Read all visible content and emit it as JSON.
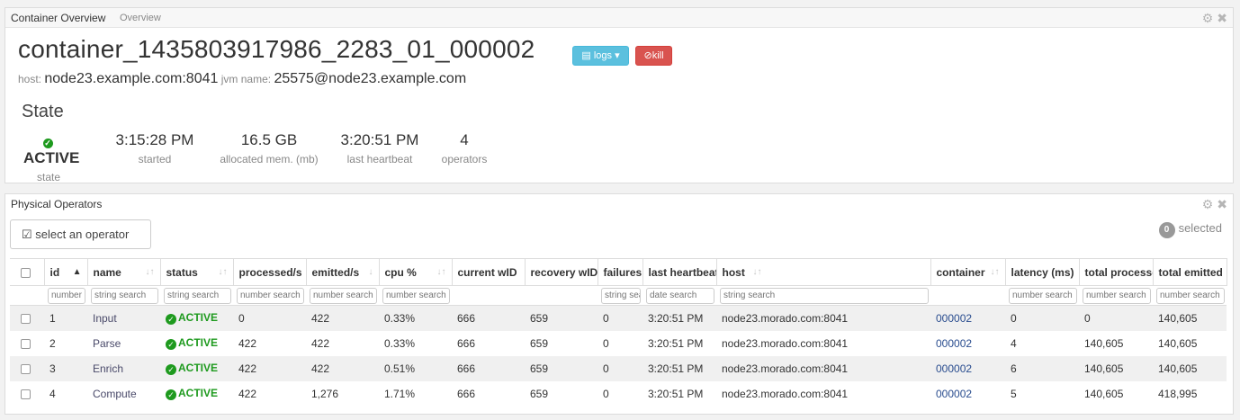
{
  "overview": {
    "title": "Container Overview",
    "subtitle": "Overview",
    "container_id": "container_1435803917986_2283_01_000002",
    "logs_label": "logs",
    "kill_label": "kill",
    "host_label": "host:",
    "host_value": "node23.example.com:8041",
    "jvm_label": "jvm name:",
    "jvm_value": "25575@node23.example.com",
    "state_title": "State",
    "stats": [
      {
        "value": "ACTIVE",
        "label": "state"
      },
      {
        "value": "3:15:28 PM",
        "label": "started"
      },
      {
        "value": "16.5 GB",
        "label": "allocated mem. (mb)"
      },
      {
        "value": "3:20:51 PM",
        "label": "last heartbeat"
      },
      {
        "value": "4",
        "label": "operators"
      }
    ]
  },
  "operators": {
    "title": "Physical Operators",
    "select_label": "select an operator",
    "selected_count": "0",
    "selected_label": "selected",
    "columns": [
      "id",
      "name",
      "status",
      "processed/s",
      "emitted/s",
      "cpu %",
      "current wID",
      "recovery wID",
      "failures",
      "last heartbeat",
      "host",
      "container",
      "latency (ms)",
      "total processed",
      "total emitted"
    ],
    "filters": [
      "number",
      "string search",
      "string search",
      "number search",
      "number search",
      "number search",
      "",
      "",
      "string search",
      "date search",
      "string search",
      "",
      "number search",
      "number search",
      "number search"
    ],
    "rows": [
      {
        "id": "1",
        "name": "Input",
        "status": "ACTIVE",
        "processed": "0",
        "emitted": "422",
        "cpu": "0.33%",
        "current_wid": "666",
        "recovery_wid": "659",
        "failures": "0",
        "last_heartbeat": "3:20:51 PM",
        "host": "node23.morado.com:8041",
        "container": "000002",
        "latency": "0",
        "total_processed": "0",
        "total_emitted": "140,605"
      },
      {
        "id": "2",
        "name": "Parse",
        "status": "ACTIVE",
        "processed": "422",
        "emitted": "422",
        "cpu": "0.33%",
        "current_wid": "666",
        "recovery_wid": "659",
        "failures": "0",
        "last_heartbeat": "3:20:51 PM",
        "host": "node23.morado.com:8041",
        "container": "000002",
        "latency": "4",
        "total_processed": "140,605",
        "total_emitted": "140,605"
      },
      {
        "id": "3",
        "name": "Enrich",
        "status": "ACTIVE",
        "processed": "422",
        "emitted": "422",
        "cpu": "0.51%",
        "current_wid": "666",
        "recovery_wid": "659",
        "failures": "0",
        "last_heartbeat": "3:20:51 PM",
        "host": "node23.morado.com:8041",
        "container": "000002",
        "latency": "6",
        "total_processed": "140,605",
        "total_emitted": "140,605"
      },
      {
        "id": "4",
        "name": "Compute",
        "status": "ACTIVE",
        "processed": "422",
        "emitted": "1,276",
        "cpu": "1.71%",
        "current_wid": "666",
        "recovery_wid": "659",
        "failures": "0",
        "last_heartbeat": "3:20:51 PM",
        "host": "node23.morado.com:8041",
        "container": "000002",
        "latency": "5",
        "total_processed": "140,605",
        "total_emitted": "418,995"
      }
    ]
  },
  "colors": {
    "active": "#1e9a1e",
    "logs_button": "#5bc0de",
    "kill_button": "#d9534f",
    "link": "#2a4d8f"
  },
  "icons": {
    "settings": "gear-icon",
    "close": "close-icon",
    "file": "file-icon",
    "ban": "ban-icon",
    "check": "check-circle-icon",
    "checkbox": "checkbox-icon"
  }
}
